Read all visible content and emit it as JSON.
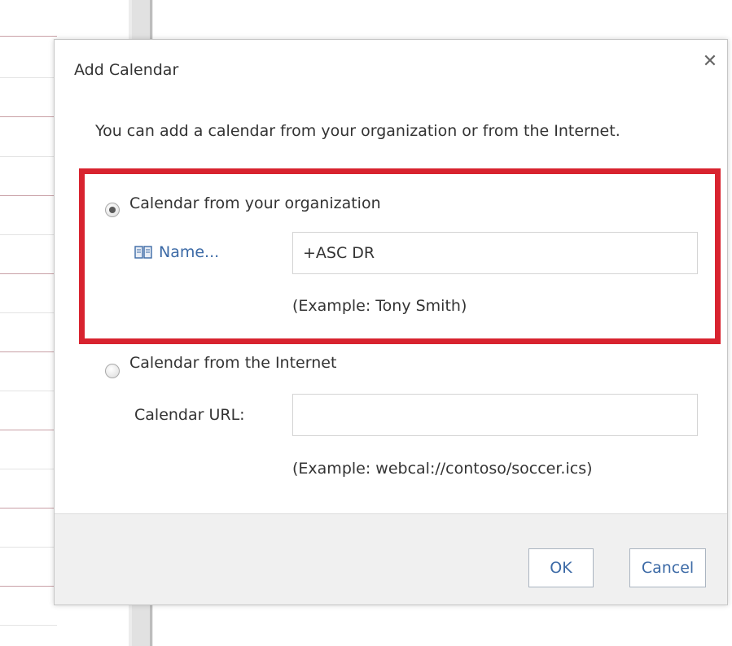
{
  "dialog": {
    "title": "Add Calendar",
    "close_glyph": "✕",
    "intro": "You can add a calendar from your organization or from the Internet."
  },
  "organization": {
    "radio_label": "Calendar from your organization",
    "checked": true,
    "name_link": "Name...",
    "name_value": "+ASC DR",
    "example": "(Example: Tony Smith)"
  },
  "internet": {
    "radio_label": "Calendar from the Internet",
    "checked": false,
    "url_label": "Calendar URL:",
    "url_value": "",
    "example": "(Example: webcal://contoso/soccer.ics)"
  },
  "footer": {
    "ok_label": "OK",
    "cancel_label": "Cancel"
  },
  "colors": {
    "highlight": "#d8232f",
    "link": "#3c6aa6",
    "footer_bg": "#f0f0f0"
  },
  "icons": {
    "address_book": "address-book-icon",
    "close": "close-icon"
  }
}
